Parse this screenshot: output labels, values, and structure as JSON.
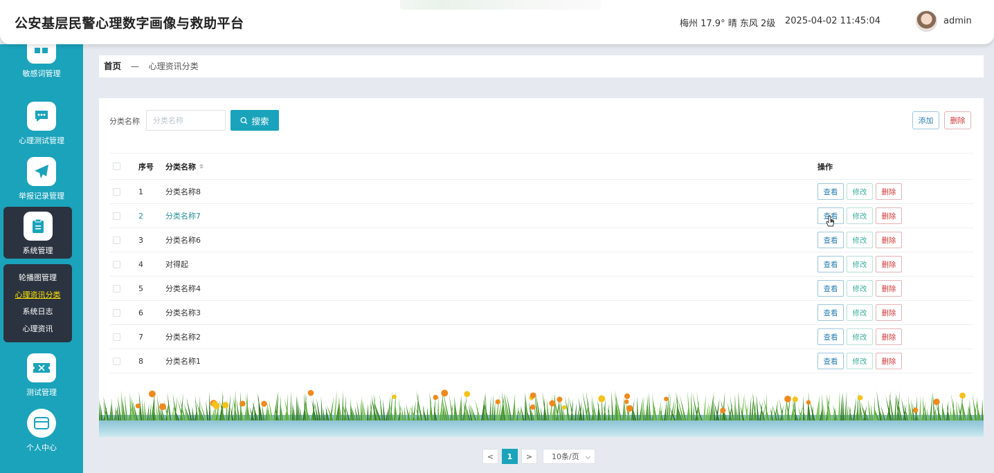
{
  "header": {
    "title": "公安基层民警心理数字画像与救助平台",
    "weather": "梅州 17.9° 晴 东风 2级",
    "datetime": "2025-04-02 11:45:04",
    "username": "admin"
  },
  "sidebar": {
    "items": [
      {
        "label": "敏感词管理",
        "icon": "grid-icon"
      },
      {
        "label": "心理测试管理",
        "icon": "chat-icon"
      },
      {
        "label": "举报记录管理",
        "icon": "paper-plane-icon"
      },
      {
        "label": "系统管理",
        "icon": "clipboard-icon"
      },
      {
        "label": "测试管理",
        "icon": "ticket-icon"
      },
      {
        "label": "个人中心",
        "icon": "card-icon"
      }
    ],
    "submenu": [
      "轮播图管理",
      "心理资讯分类",
      "系统日志",
      "心理资讯"
    ]
  },
  "breadcrumb": {
    "home": "首页",
    "separator": "—",
    "current": "心理资讯分类"
  },
  "search": {
    "label": "分类名称",
    "placeholder": "分类名称",
    "value": "",
    "button": "搜索"
  },
  "toolbar": {
    "add": "添加",
    "delete": "删除"
  },
  "table": {
    "columns": {
      "index": "序号",
      "name": "分类名称",
      "ops": "操作"
    },
    "op_labels": {
      "view": "查看",
      "edit": "修改",
      "delete": "删除"
    },
    "rows": [
      {
        "index": "1",
        "name": "分类名称8"
      },
      {
        "index": "2",
        "name": "分类名称7"
      },
      {
        "index": "3",
        "name": "分类名称6"
      },
      {
        "index": "4",
        "name": "对得起"
      },
      {
        "index": "5",
        "name": "分类名称4"
      },
      {
        "index": "6",
        "name": "分类名称3"
      },
      {
        "index": "7",
        "name": "分类名称2"
      },
      {
        "index": "8",
        "name": "分类名称1"
      }
    ]
  },
  "pagination": {
    "prev": "<",
    "current": "1",
    "next": ">",
    "page_size": "10条/页"
  },
  "colors": {
    "accent": "#1aa3bb",
    "sidebar_active": "#2b3340",
    "submenu_current": "#ffe600"
  }
}
